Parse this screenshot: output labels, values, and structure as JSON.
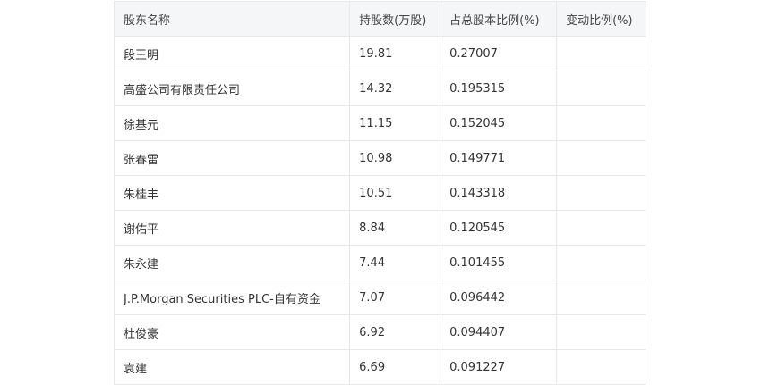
{
  "table": {
    "headers": {
      "name": "股东名称",
      "shares": "持股数(万股)",
      "pct": "占总股本比例(%)",
      "change": "变动比例(%)"
    },
    "rows": [
      {
        "name": "段王明",
        "shares": "19.81",
        "pct": "0.27007",
        "change": ""
      },
      {
        "name": "高盛公司有限责任公司",
        "shares": "14.32",
        "pct": "0.195315",
        "change": ""
      },
      {
        "name": "徐基元",
        "shares": "11.15",
        "pct": "0.152045",
        "change": ""
      },
      {
        "name": "张春雷",
        "shares": "10.98",
        "pct": "0.149771",
        "change": ""
      },
      {
        "name": "朱桂丰",
        "shares": "10.51",
        "pct": "0.143318",
        "change": ""
      },
      {
        "name": "谢佑平",
        "shares": "8.84",
        "pct": "0.120545",
        "change": ""
      },
      {
        "name": "朱永建",
        "shares": "7.44",
        "pct": "0.101455",
        "change": ""
      },
      {
        "name": "J.P.Morgan Securities PLC-自有资金",
        "shares": "7.07",
        "pct": "0.096442",
        "change": ""
      },
      {
        "name": "杜俊豪",
        "shares": "6.92",
        "pct": "0.094407",
        "change": ""
      },
      {
        "name": "袁建",
        "shares": "6.69",
        "pct": "0.091227",
        "change": ""
      }
    ]
  }
}
